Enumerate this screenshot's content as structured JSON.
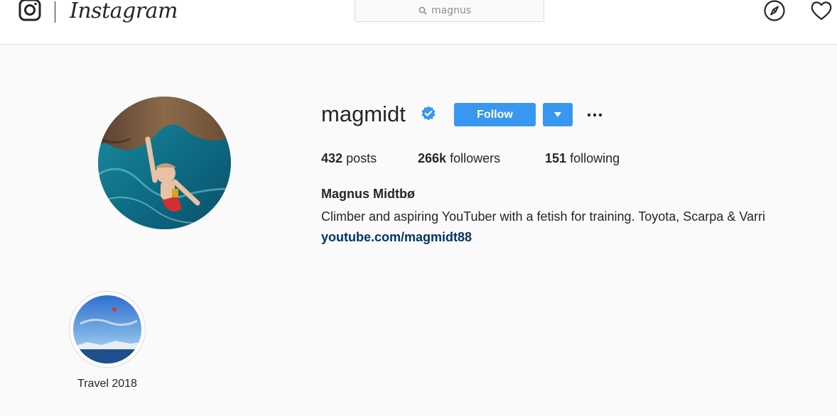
{
  "nav": {
    "wordmark": "Instagram",
    "search": {
      "value": "magnus"
    },
    "icons": [
      "instagram-glyph-icon",
      "search-icon",
      "explore-compass-icon",
      "heart-icon"
    ]
  },
  "profile": {
    "username": "magmidt",
    "verified": true,
    "follow_label": "Follow",
    "stats": {
      "posts_count": "432",
      "posts_label": "posts",
      "followers_count": "266k",
      "followers_label": "followers",
      "following_count": "151",
      "following_label": "following"
    },
    "full_name": "Magnus Midtbø",
    "bio": "Climber and aspiring YouTuber with a fetish for training. Toyota, Scarpa & Varri",
    "link": "youtube.com/magmidt88"
  },
  "highlights": [
    {
      "label": "Travel 2018"
    }
  ],
  "colors": {
    "accent_blue": "#3897f0",
    "verified_blue": "#3897f0",
    "link_blue": "#003569",
    "background": "#fafafa",
    "border": "#dbdbdb"
  }
}
